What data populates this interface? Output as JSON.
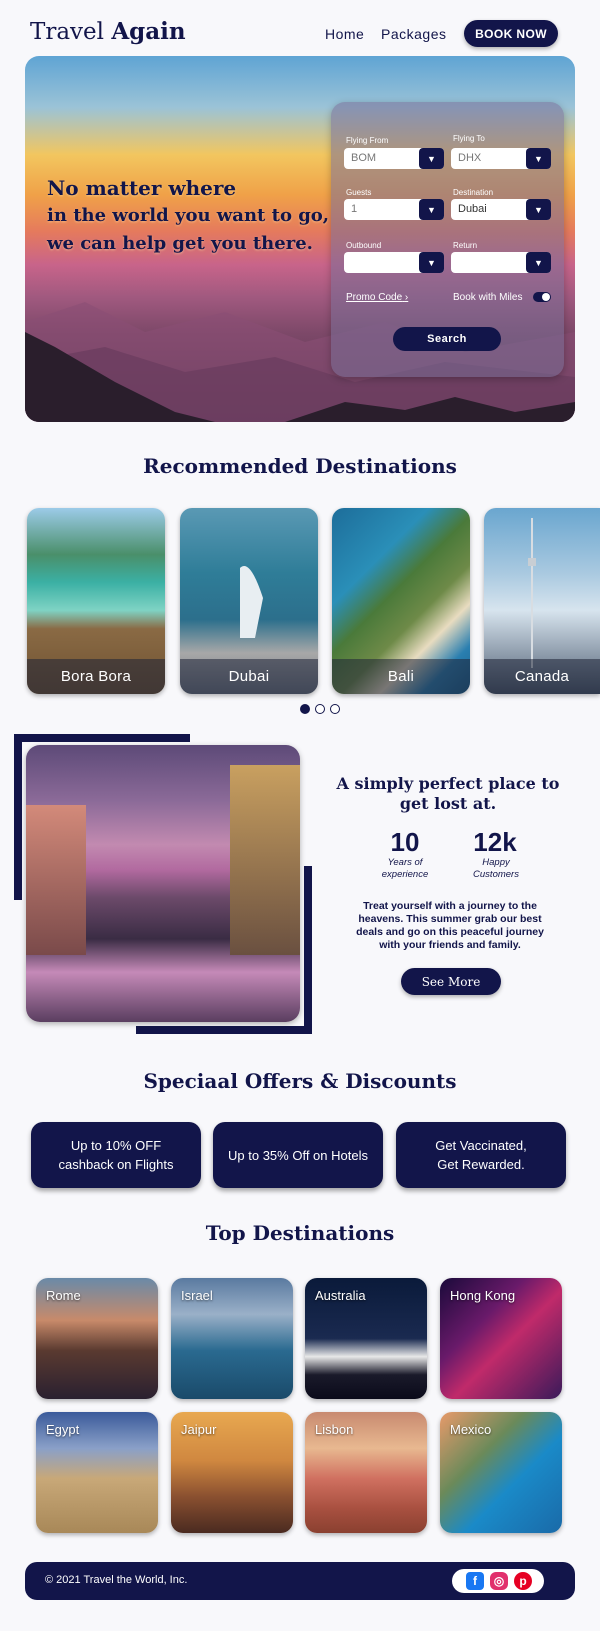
{
  "header": {
    "logo_light": "Travel",
    "logo_bold": "Again",
    "nav": [
      "Home",
      "Packages"
    ],
    "cta": "BOOK NOW"
  },
  "hero": {
    "line1": "No matter where",
    "line2": "in the world you want to go,",
    "line3": "we can help get you there."
  },
  "search": {
    "flying_from_label": "Flying From",
    "flying_from_value": "BOM",
    "flying_to_label": "Flying To",
    "flying_to_value": "DHX",
    "guests_label": "Guests",
    "guests_value": "1",
    "destination_label": "Destination",
    "destination_value": "Dubai",
    "outbound_label": "Outbound",
    "outbound_value": "",
    "return_label": "Return",
    "return_value": "",
    "promo": "Promo Code",
    "miles": "Book with Miles",
    "miles_on": true,
    "button": "Search"
  },
  "recommended": {
    "title": "Recommended Destinations",
    "cards": [
      "Bora Bora",
      "Dubai",
      "Bali",
      "Canada"
    ],
    "active_dot": 0
  },
  "feature": {
    "title": "A simply perfect place to get lost at.",
    "stats": [
      {
        "num": "10",
        "label1": "Years of",
        "label2": "experience"
      },
      {
        "num": "12k",
        "label1": "Happy",
        "label2": "Customers"
      }
    ],
    "desc": "Treat yourself with a journey to the heavens. This summer grab our best deals and go on this peaceful journey with your friends and family.",
    "button": "See More"
  },
  "offers": {
    "title": "Speciaal Offers & Discounts",
    "items": [
      {
        "l1": "Up to 10% OFF",
        "l2": "cashback on Flights"
      },
      {
        "l1": "Up to 35% Off on Hotels",
        "l2": ""
      },
      {
        "l1": "Get Vaccinated,",
        "l2": "Get Rewarded."
      }
    ]
  },
  "top": {
    "title": "Top Destinations",
    "places": [
      "Rome",
      "Israel",
      "Australia",
      "Hong Kong",
      "Egypt",
      "Jaipur",
      "Lisbon",
      "Mexico"
    ]
  },
  "footer": {
    "copy": "© 2021 Travel the World, Inc.",
    "social": [
      "facebook-icon",
      "instagram-icon",
      "pinterest-icon"
    ]
  },
  "colors": {
    "primary": "#12154a",
    "background": "#f8f8fb"
  }
}
